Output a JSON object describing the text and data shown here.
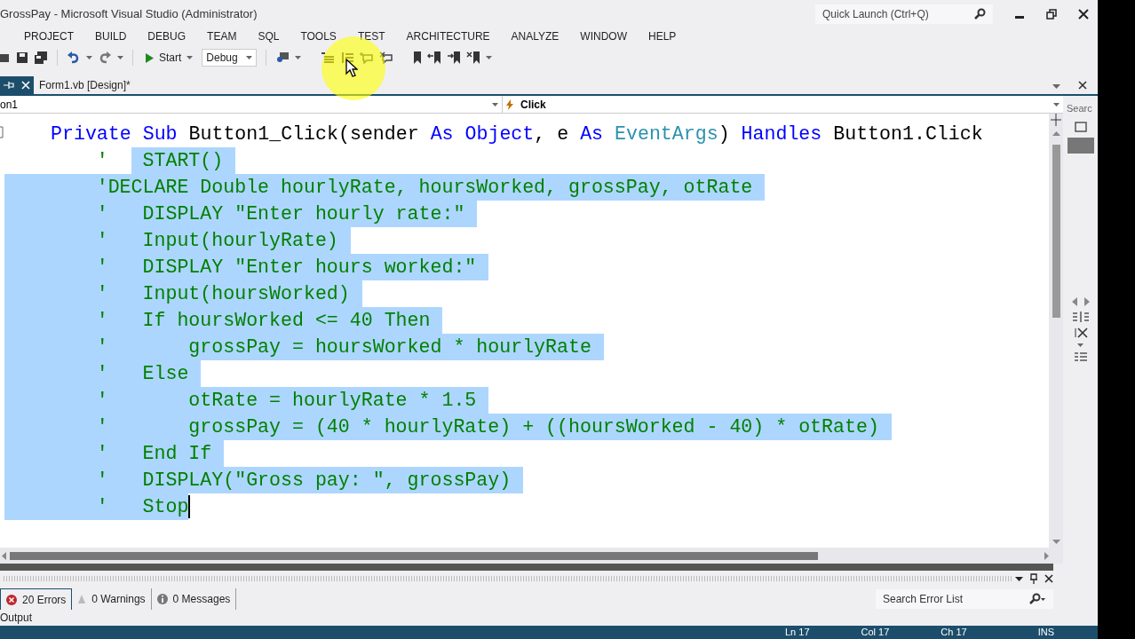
{
  "window": {
    "title": "GrossPay - Microsoft Visual Studio (Administrator)",
    "quick_launch": {
      "placeholder": "Quick Launch (Ctrl+Q)"
    }
  },
  "menu": [
    "PROJECT",
    "BUILD",
    "DEBUG",
    "TEAM",
    "SQL",
    "TOOLS",
    "TEST",
    "ARCHITECTURE",
    "ANALYZE",
    "WINDOW",
    "HELP"
  ],
  "toolbar": {
    "start": "Start",
    "configuration": "Debug"
  },
  "tabs": [
    {
      "label": "Form1.vb [Design]*",
      "selected": false
    }
  ],
  "navigation": {
    "left": "on1",
    "right": "Click"
  },
  "code": [
    {
      "kind": "code",
      "segments": [
        {
          "text": "Private Sub",
          "kind": "keyword",
          "selected": false
        },
        {
          "text": " Button1_Click(sender ",
          "kind": "plain",
          "selected": false
        },
        {
          "text": "As Object",
          "kind": "keyword",
          "selected": false
        },
        {
          "text": ", e ",
          "kind": "plain",
          "selected": false
        },
        {
          "text": "As",
          "kind": "keyword",
          "selected": false
        },
        {
          "text": " EventArgs",
          "kind": "type",
          "selected": false
        },
        {
          "text": ") ",
          "kind": "plain",
          "selected": false
        },
        {
          "text": "Handles",
          "kind": "keyword",
          "selected": false
        },
        {
          "text": " Button1.Click",
          "kind": "plain",
          "selected": false
        }
      ]
    },
    {
      "kind": "comment",
      "segments": [
        {
          "text": "        '  ",
          "selected": false
        },
        {
          "text": " START()",
          "selected": true
        }
      ]
    },
    {
      "kind": "comment",
      "segments": [
        {
          "text": "        'DECLARE Double hourlyRate, hoursWorked, grossPay, otRate",
          "selected": true
        }
      ]
    },
    {
      "kind": "comment",
      "segments": [
        {
          "text": "        '   DISPLAY \"Enter hourly rate:\"",
          "selected": true
        }
      ]
    },
    {
      "kind": "comment",
      "segments": [
        {
          "text": "        '   Input(hourlyRate)",
          "selected": true
        }
      ]
    },
    {
      "kind": "comment",
      "segments": [
        {
          "text": "        '   DISPLAY \"Enter hours worked:\"",
          "selected": true
        }
      ]
    },
    {
      "kind": "comment",
      "segments": [
        {
          "text": "        '   Input(hoursWorked)",
          "selected": true
        }
      ]
    },
    {
      "kind": "comment",
      "segments": [
        {
          "text": "        '   If hoursWorked <= 40 Then",
          "selected": true
        }
      ]
    },
    {
      "kind": "comment",
      "segments": [
        {
          "text": "        '       grossPay = hoursWorked * hourlyRate",
          "selected": true
        }
      ]
    },
    {
      "kind": "comment",
      "segments": [
        {
          "text": "        '   Else",
          "selected": true
        }
      ]
    },
    {
      "kind": "comment",
      "segments": [
        {
          "text": "        '       otRate = hourlyRate * 1.5",
          "selected": true
        }
      ]
    },
    {
      "kind": "comment",
      "segments": [
        {
          "text": "        '       grossPay = (40 * hourlyRate) + ((hoursWorked - 40) * otRate)",
          "selected": true
        }
      ]
    },
    {
      "kind": "comment",
      "segments": [
        {
          "text": "        '   End If",
          "selected": true
        }
      ]
    },
    {
      "kind": "comment",
      "segments": [
        {
          "text": "        '   DISPLAY(\"Gross pay: \", grossPay)",
          "selected": true
        }
      ]
    },
    {
      "kind": "comment",
      "segments": [
        {
          "text": "        '   Stop",
          "selected": true
        }
      ]
    }
  ],
  "error_list": {
    "tabs": [
      {
        "label": "20 Errors",
        "kind": "error",
        "selected": true
      },
      {
        "label": "0 Warnings",
        "kind": "warning",
        "selected": false
      },
      {
        "label": "0 Messages",
        "kind": "info",
        "selected": false
      }
    ],
    "search": {
      "placeholder": "Search Error List"
    },
    "output_tab": "Output"
  },
  "side_panel": {
    "search": "Searc"
  },
  "status_bar": [
    "Ln 17",
    "Col 17",
    "Ch 17",
    "INS"
  ]
}
